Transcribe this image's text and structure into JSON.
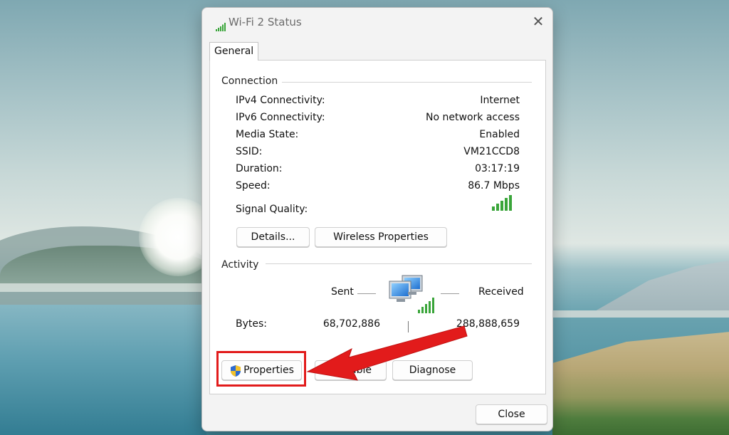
{
  "window": {
    "title": "Wi-Fi 2 Status",
    "close_glyph": "✕"
  },
  "tabs": [
    {
      "label": "General",
      "selected": true
    }
  ],
  "connection": {
    "group_label": "Connection",
    "rows": [
      {
        "label": "IPv4 Connectivity:",
        "value": "Internet"
      },
      {
        "label": "IPv6 Connectivity:",
        "value": "No network access"
      },
      {
        "label": "Media State:",
        "value": "Enabled"
      },
      {
        "label": "SSID:",
        "value": "VM21CCD8"
      },
      {
        "label": "Duration:",
        "value": "03:17:19"
      },
      {
        "label": "Speed:",
        "value": "86.7 Mbps"
      }
    ],
    "signal_label": "Signal Quality:",
    "signal_bars": 5,
    "buttons": {
      "details": "Details...",
      "wireless_properties": "Wireless Properties"
    }
  },
  "activity": {
    "group_label": "Activity",
    "sent_label": "Sent",
    "received_label": "Received",
    "bytes_label": "Bytes:",
    "bytes_sent": "68,702,886",
    "bytes_received": "288,888,659"
  },
  "actions": {
    "properties": "Properties",
    "disable": "Disable",
    "diagnose": "Diagnose",
    "close": "Close"
  },
  "icons": {
    "title": "wifi-signal-icon",
    "shield": "uac-shield-icon",
    "network": "network-computers-icon"
  },
  "colors": {
    "signal_green": "#3aa53a",
    "annotation_red": "#e21b1b",
    "shield_blue": "#2d6bd1",
    "shield_yellow": "#f3c22b"
  }
}
